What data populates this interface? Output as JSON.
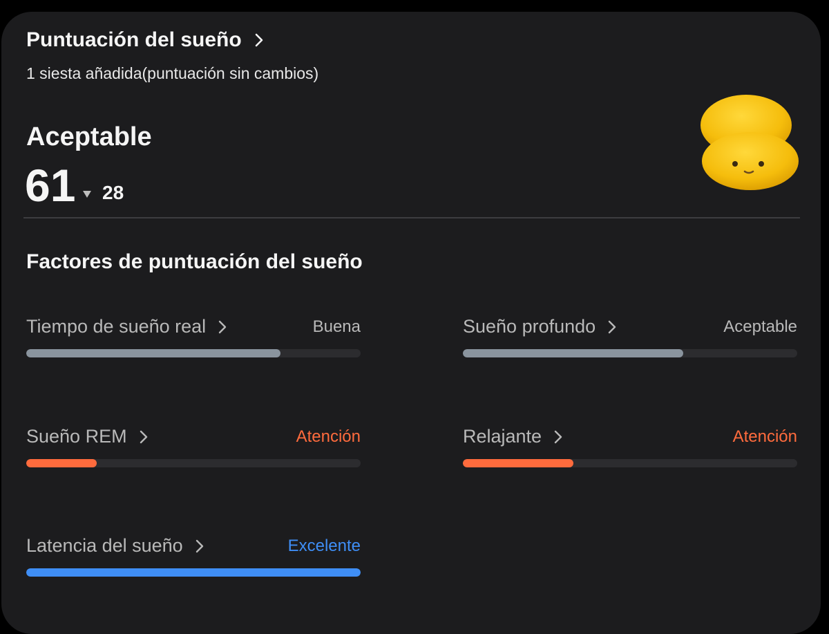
{
  "header": {
    "title": "Puntuación del sueño",
    "subtitle": "1 siesta añadida(puntuación sin cambios)"
  },
  "summary": {
    "rating": "Aceptable",
    "score": "61",
    "delta": "28",
    "delta_direction": "down",
    "mascot_icon": "yellow-fluffy-mascot"
  },
  "factors_section": {
    "title": "Factores de puntuación del sueño",
    "colors": {
      "good": "#8a949e",
      "attention": "#ff6b3d",
      "excellent": "#3f8ef5",
      "track": "#2c2c2f"
    },
    "items": [
      {
        "label": "Tiempo de sueño real",
        "status": "Buena",
        "status_color": "#b9b9b9",
        "level": 0.76,
        "bar_color": "#8a949e"
      },
      {
        "label": "Sueño profundo",
        "status": "Aceptable",
        "status_color": "#b9b9b9",
        "level": 0.66,
        "bar_color": "#8a949e"
      },
      {
        "label": "Sueño REM",
        "status": "Atención",
        "status_color": "#ff6b3d",
        "level": 0.21,
        "bar_color": "#ff6b3d"
      },
      {
        "label": "Relajante",
        "status": "Atención",
        "status_color": "#ff6b3d",
        "level": 0.33,
        "bar_color": "#ff6b3d"
      },
      {
        "label": "Latencia del sueño",
        "status": "Excelente",
        "status_color": "#3f8ef5",
        "level": 1.0,
        "bar_color": "#3f8ef5"
      }
    ]
  }
}
